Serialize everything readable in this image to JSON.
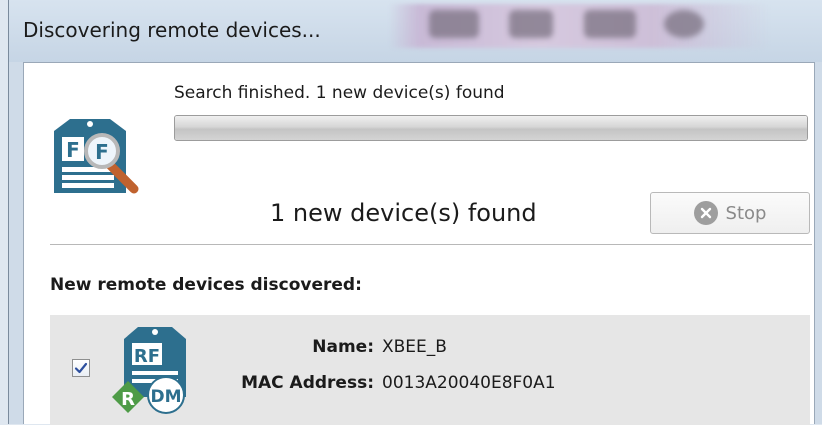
{
  "window": {
    "title": "Discovering remote devices..."
  },
  "search": {
    "status_text": "Search finished. 1 new device(s) found",
    "progress": 1.0,
    "found_text": "1 new device(s) found",
    "stop_label": "Stop"
  },
  "devices_section": {
    "label": "New remote devices discovered:",
    "items": [
      {
        "checked": true,
        "name_label": "Name:",
        "name_value": "XBEE_B",
        "mac_label": "MAC Address:",
        "mac_value": "0013A20040E8F0A1"
      }
    ]
  },
  "icons": {
    "app": "xctu-search-icon",
    "device": "remote-device-icon",
    "stop": "stop-circle-x-icon",
    "checkbox": "checkmark-icon"
  },
  "colors": {
    "icon_blue": "#2d6f8e",
    "icon_green": "#4e9b47",
    "row_background": "#e6e6e6",
    "disabled_text": "#8a8a8a"
  }
}
